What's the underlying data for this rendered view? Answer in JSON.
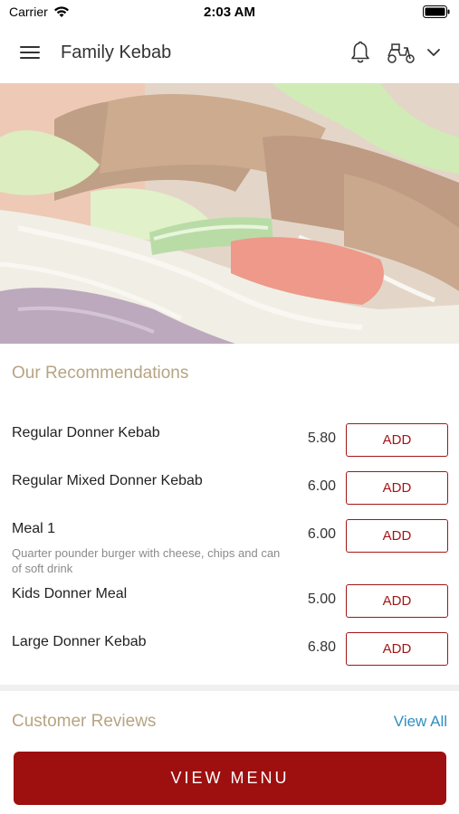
{
  "status_bar": {
    "carrier": "Carrier",
    "time": "2:03 AM"
  },
  "header": {
    "title": "Family Kebab",
    "icons": [
      "menu-icon",
      "bell-icon",
      "scooter-icon",
      "chevron-down-icon"
    ]
  },
  "recommendations": {
    "title": "Our Recommendations",
    "items": [
      {
        "name": "Regular Donner Kebab",
        "description": "",
        "price": "5.80",
        "button": "ADD"
      },
      {
        "name": "Regular Mixed Donner Kebab",
        "description": "",
        "price": "6.00",
        "button": "ADD"
      },
      {
        "name": "Meal 1",
        "description": "Quarter pounder burger with cheese, chips and can of soft drink",
        "price": "6.00",
        "button": "ADD"
      },
      {
        "name": "Kids Donner Meal",
        "description": "",
        "price": "5.00",
        "button": "ADD"
      },
      {
        "name": "Large Donner Kebab",
        "description": "",
        "price": "6.80",
        "button": "ADD"
      }
    ]
  },
  "reviews": {
    "title": "Customer Reviews",
    "view_all": "View All"
  },
  "footer": {
    "view_menu": "VIEW MENU"
  },
  "colors": {
    "accent": "#9e0f0f",
    "section_title": "#b7a482",
    "link": "#2f8fc2"
  }
}
